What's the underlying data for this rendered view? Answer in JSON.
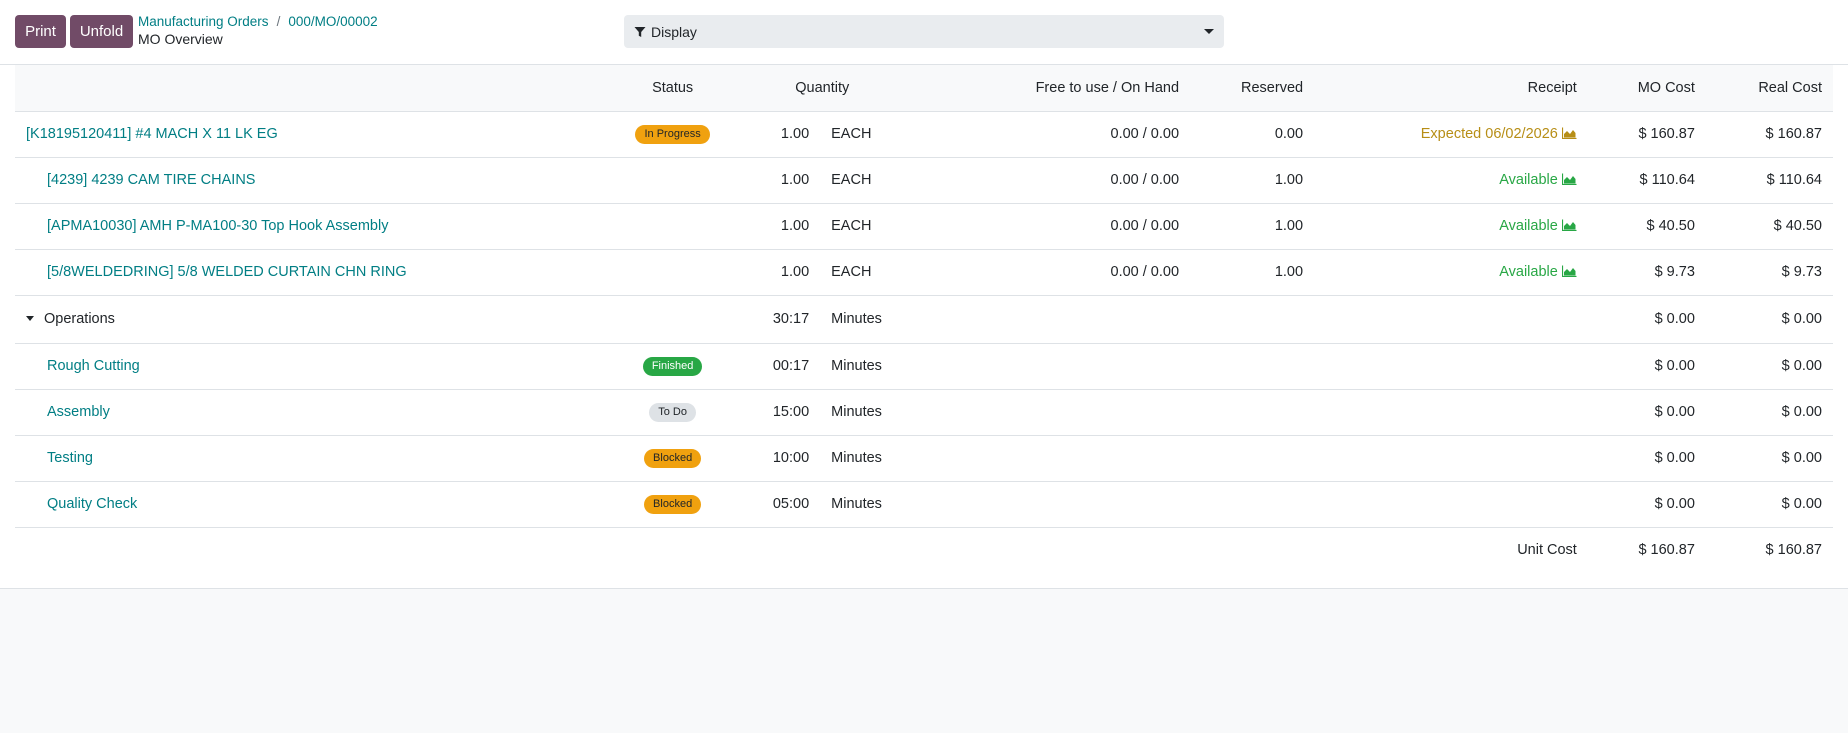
{
  "toolbar": {
    "print_label": "Print",
    "unfold_label": "Unfold",
    "display_label": "Display"
  },
  "breadcrumb": {
    "parent": "Manufacturing Orders",
    "current": "000/MO/00002",
    "title": "MO Overview"
  },
  "columns": {
    "status": "Status",
    "quantity": "Quantity",
    "free_on_hand": "Free to use / On Hand",
    "reserved": "Reserved",
    "receipt": "Receipt",
    "mo_cost": "MO Cost",
    "real_cost": "Real Cost"
  },
  "product": {
    "name": "[K18195120411] #4 MACH X 11 LK EG",
    "status": "In Progress",
    "quantity": "1.00",
    "uom": "EACH",
    "free_on_hand": "0.00 / 0.00",
    "reserved": "0.00",
    "receipt": "Expected 06/02/2026",
    "mo_cost": "$ 160.87",
    "real_cost": "$ 160.87"
  },
  "components": [
    {
      "name": "[4239] 4239 CAM TIRE CHAINS",
      "quantity": "1.00",
      "uom": "EACH",
      "free_on_hand": "0.00 / 0.00",
      "reserved": "1.00",
      "receipt": "Available",
      "mo_cost": "$ 110.64",
      "real_cost": "$ 110.64"
    },
    {
      "name": "[APMA10030] AMH P-MA100-30 Top Hook Assembly",
      "quantity": "1.00",
      "uom": "EACH",
      "free_on_hand": "0.00 / 0.00",
      "reserved": "1.00",
      "receipt": "Available",
      "mo_cost": "$ 40.50",
      "real_cost": "$ 40.50"
    },
    {
      "name": "[5/8WELDEDRING] 5/8 WELDED CURTAIN CHN RING",
      "quantity": "1.00",
      "uom": "EACH",
      "free_on_hand": "0.00 / 0.00",
      "reserved": "1.00",
      "receipt": "Available",
      "mo_cost": "$ 9.73",
      "real_cost": "$ 9.73"
    }
  ],
  "operations": {
    "label": "Operations",
    "quantity": "30:17",
    "uom": "Minutes",
    "mo_cost": "$ 0.00",
    "real_cost": "$ 0.00",
    "items": [
      {
        "name": "Rough Cutting",
        "status": "Finished",
        "quantity": "00:17",
        "uom": "Minutes",
        "mo_cost": "$ 0.00",
        "real_cost": "$ 0.00"
      },
      {
        "name": "Assembly",
        "status": "To Do",
        "quantity": "15:00",
        "uom": "Minutes",
        "mo_cost": "$ 0.00",
        "real_cost": "$ 0.00"
      },
      {
        "name": "Testing",
        "status": "Blocked",
        "quantity": "10:00",
        "uom": "Minutes",
        "mo_cost": "$ 0.00",
        "real_cost": "$ 0.00"
      },
      {
        "name": "Quality Check",
        "status": "Blocked",
        "quantity": "05:00",
        "uom": "Minutes",
        "mo_cost": "$ 0.00",
        "real_cost": "$ 0.00"
      }
    ]
  },
  "total": {
    "label": "Unit Cost",
    "mo_cost": "$ 160.87",
    "real_cost": "$ 160.87"
  },
  "colors": {
    "brand": "#714b67",
    "link": "#017e84",
    "warning": "#f0a10f",
    "success": "#28a745",
    "expected": "#b78e16"
  },
  "icons": {
    "filter": "filter-icon",
    "caret": "caret-down-icon",
    "forecast": "area-chart-icon"
  }
}
